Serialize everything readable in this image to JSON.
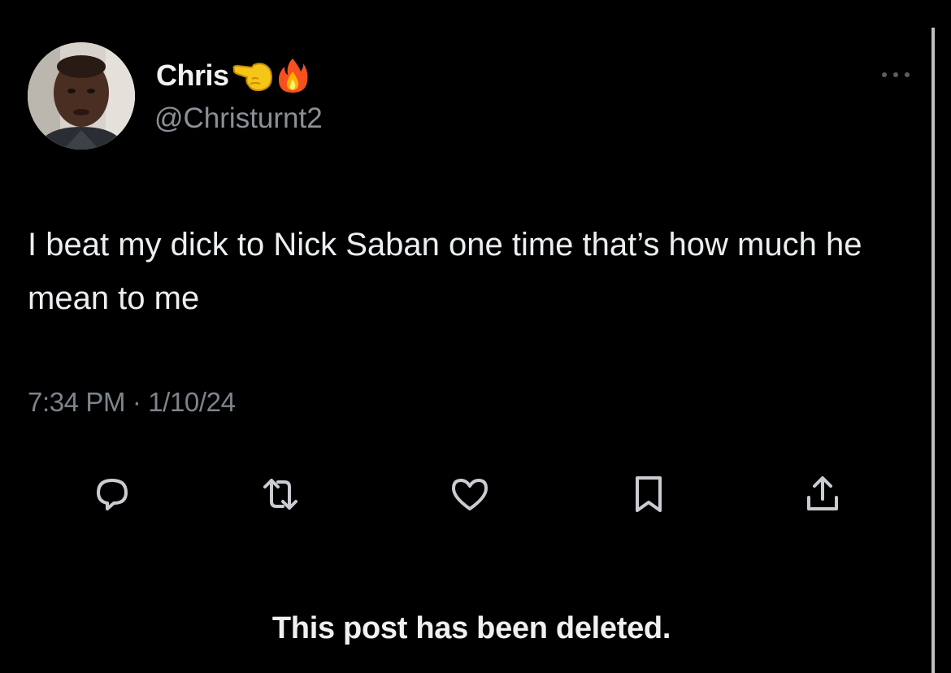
{
  "post": {
    "author": {
      "display_name": "Chris",
      "name_emojis": [
        "pointing-left-emoji",
        "fire-emoji"
      ],
      "handle": "@Christurnt2"
    },
    "text": "I beat my dick to Nick Saban one time that’s how much he mean to me",
    "timestamp": "7:34 PM · 1/10/24",
    "actions": [
      "reply-icon",
      "repost-icon",
      "like-icon",
      "bookmark-icon",
      "share-icon"
    ],
    "more_icon": "more-options-icon",
    "deleted_notice": "This post has been deleted."
  },
  "colors": {
    "background": "#000000",
    "text_primary": "#e7e9ea",
    "text_secondary": "#8b9097",
    "icon": "#c9ccd0"
  }
}
